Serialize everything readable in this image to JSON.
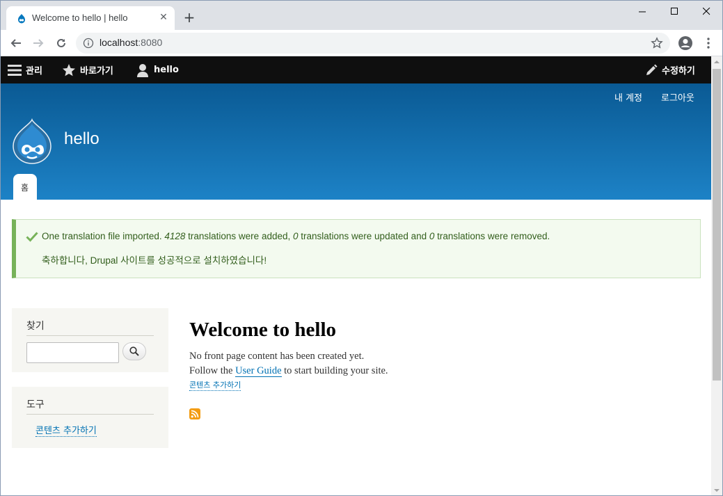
{
  "browser": {
    "tab_title": "Welcome to hello | hello",
    "url_host": "localhost",
    "url_port": ":8080"
  },
  "admin_toolbar": {
    "manage": "관리",
    "shortcuts": "바로가기",
    "user": "hello",
    "edit": "수정하기"
  },
  "header": {
    "my_account": "내 계정",
    "logout": "로그아웃",
    "site_name": "hello",
    "home_tab": "홈"
  },
  "status": {
    "part1": "One translation file imported. ",
    "added": "4128",
    "part2": " translations were added, ",
    "updated": "0",
    "part3": " translations were updated and ",
    "removed": "0",
    "part4": " translations were removed.",
    "line2": "축하합니다, Drupal 사이트를 성공적으로 설치하였습니다!"
  },
  "sidebar": {
    "search_title": "찾기",
    "tools_title": "도구",
    "tools_link": "콘텐츠 추가하기"
  },
  "main": {
    "title": "Welcome to hello",
    "p1": "No front page content has been created yet.",
    "p2_before": "Follow the ",
    "p2_link": "User Guide",
    "p2_after": " to start building your site.",
    "add_content": "콘텐츠 추가하기"
  },
  "colors": {
    "admin_bar": "#0f0f0f",
    "header_top": "#0a5a94",
    "header_bottom": "#1d82c6",
    "link": "#0071b3",
    "status_border": "#77b259"
  }
}
